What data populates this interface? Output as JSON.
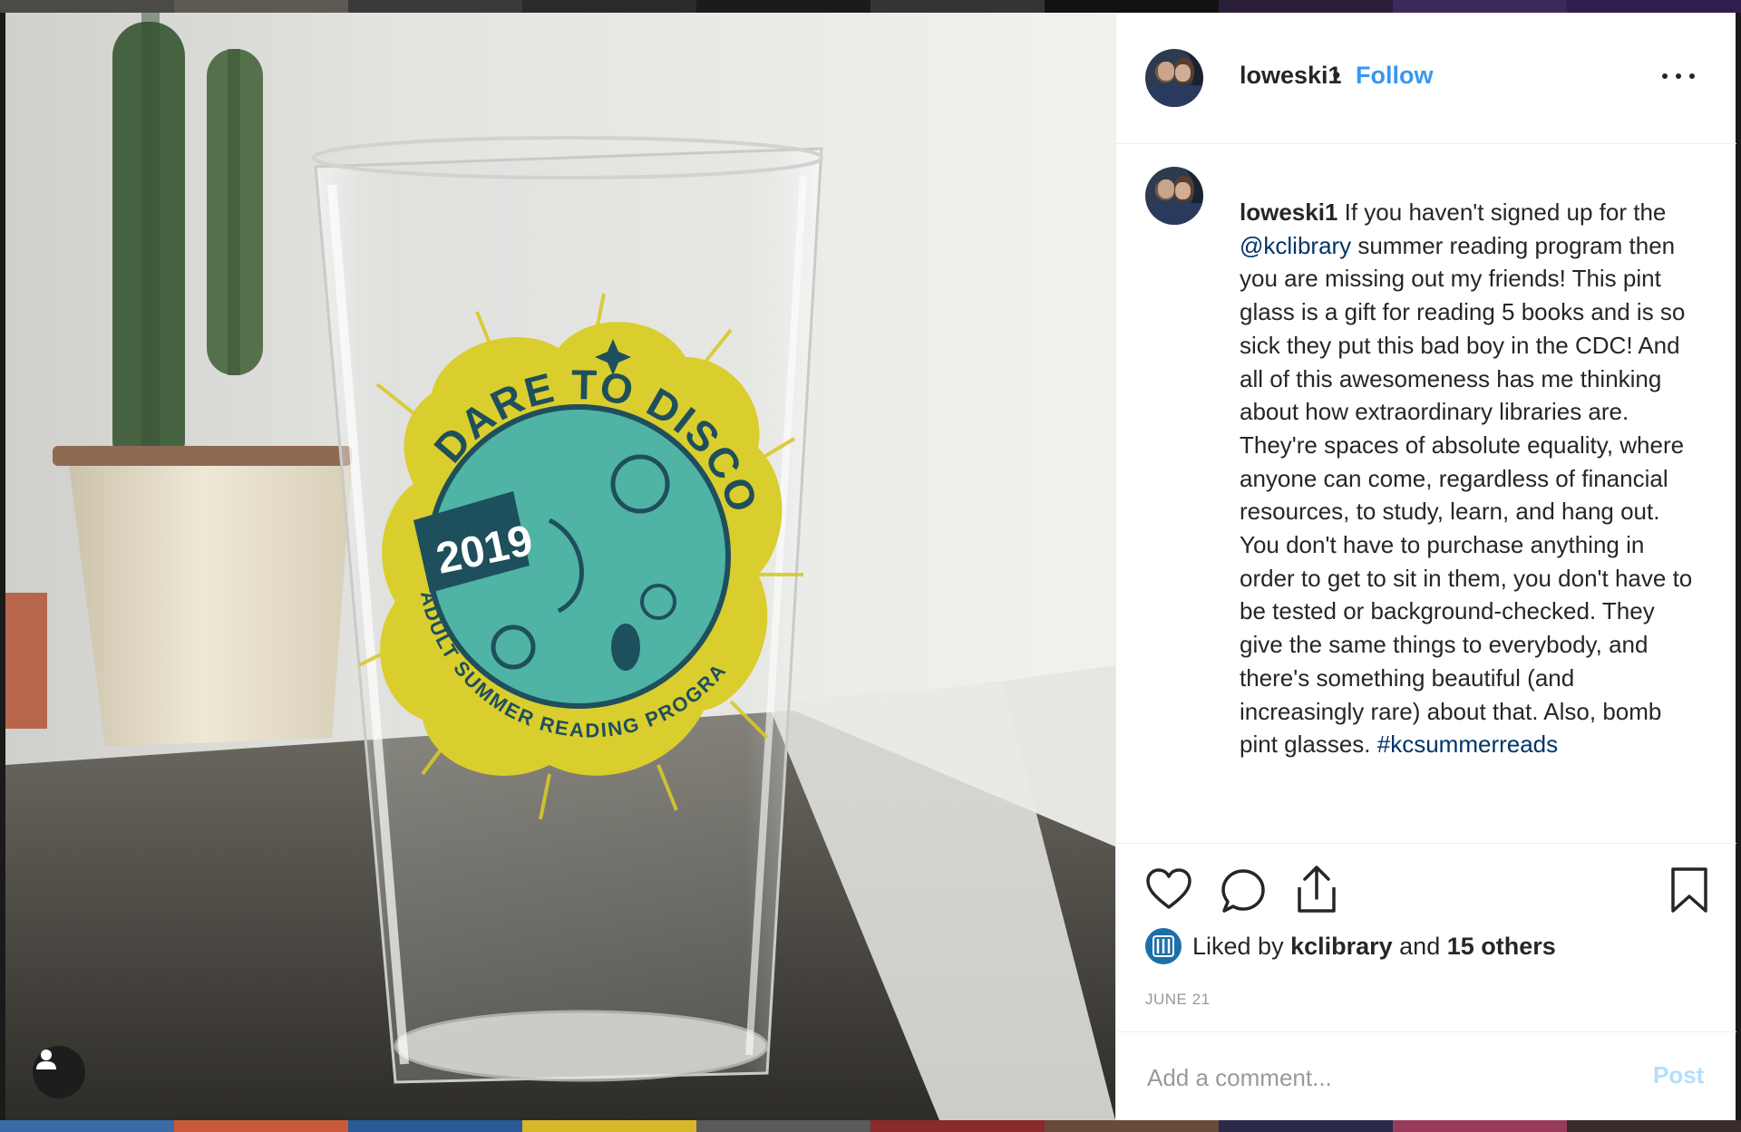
{
  "post": {
    "username": "loweski1",
    "separator": "•",
    "follow_label": "Follow",
    "caption": {
      "username": "loweski1",
      "text_1": " If you haven't signed up for the ",
      "mention": "@kclibrary",
      "text_2": " summer reading program then you are missing out my friends! This pint glass is a gift for reading 5 books and is so sick they put this bad boy in the CDC! And all of this awesomeness has me thinking about how extraordinary libraries are. They're spaces of absolute equality, where anyone can come, regardless of financial resources, to study, learn, and hang out. You don't have to purchase anything in order to get to sit in them, you don't have to be tested or background-checked. They give the same things to everybody, and there's something beautiful (and increasingly rare) about that. Also, bomb pint glasses. ",
      "hashtag": "#kcsummerreads"
    },
    "likes": {
      "prefix": "Liked by ",
      "liker": "kclibrary",
      "suffix": " and ",
      "others": "15 others"
    },
    "date": "JUNE 21",
    "comment": {
      "placeholder": "Add a comment...",
      "post_label": "Post"
    },
    "photo": {
      "logo_title": "DARE TO DISCOVER",
      "logo_year": "2019",
      "logo_subtitle": "ADULT SUMMER READING PROGRAM"
    }
  },
  "colors": {
    "link": "#3897f0",
    "mention": "#003569",
    "text": "#262626",
    "muted": "#999999",
    "logo_yellow": "#d8c92a",
    "logo_teal": "#4fb3a6",
    "logo_navy": "#1e4f5c"
  },
  "icons": [
    "user-tag-icon",
    "more-options-icon",
    "heart-icon",
    "comment-icon",
    "share-icon",
    "bookmark-icon"
  ]
}
